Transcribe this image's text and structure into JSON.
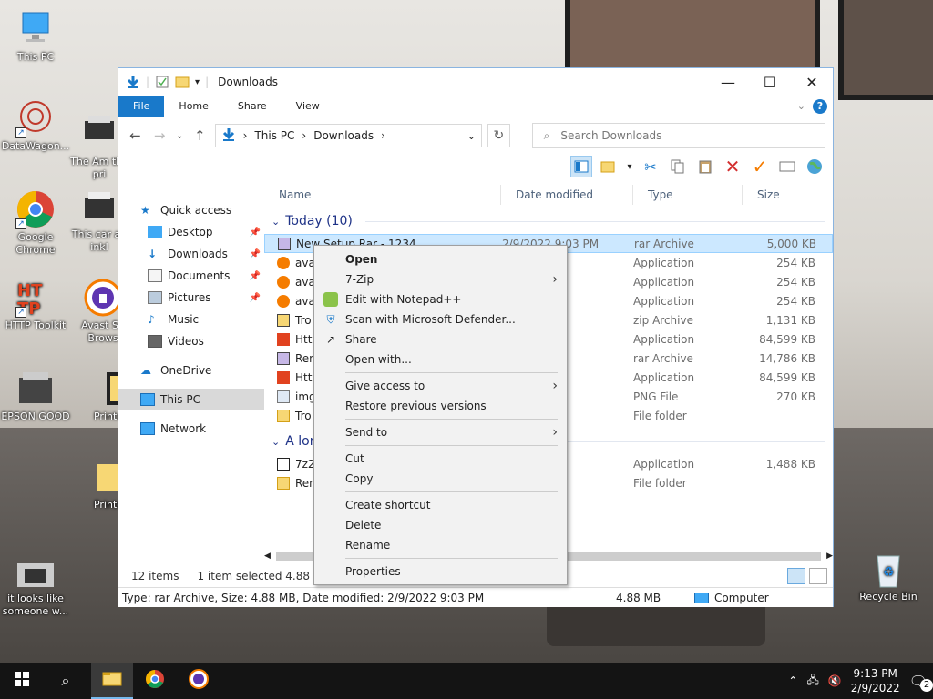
{
  "desktop": {
    "icons": [
      {
        "label": "This PC"
      },
      {
        "label": "DataWagon..."
      },
      {
        "label": "The Am the pri"
      },
      {
        "label": "Google Chrome"
      },
      {
        "label": "This car an inkl"
      },
      {
        "label": "HTTP Toolkit"
      },
      {
        "label": "Avast Se Brows"
      },
      {
        "label": "EPSON GOOD"
      },
      {
        "label": "Printe"
      },
      {
        "label": "Printe"
      },
      {
        "label": "it looks like someone w..."
      },
      {
        "label": "Recycle Bin"
      }
    ]
  },
  "window": {
    "title": "Downloads",
    "ribbon_tabs": [
      "File",
      "Home",
      "Share",
      "View"
    ],
    "address": {
      "crumb1": "This PC",
      "crumb2": "Downloads"
    },
    "search_placeholder": "Search Downloads",
    "nav_pane": {
      "quick_access": "Quick access",
      "desktop": "Desktop",
      "downloads": "Downloads",
      "documents": "Documents",
      "pictures": "Pictures",
      "music": "Music",
      "videos": "Videos",
      "onedrive": "OneDrive",
      "this_pc": "This PC",
      "network": "Network"
    },
    "columns": {
      "name": "Name",
      "date": "Date modified",
      "type": "Type",
      "size": "Size"
    },
    "groups": {
      "today": "Today (10)",
      "long_ago": "A lon"
    },
    "files_today": [
      {
        "name": "New Setup Rar - 1234",
        "date": "2/9/2022 9:03 PM",
        "type": "rar Archive",
        "size": "5,000 KB"
      },
      {
        "name": "ava",
        "date": "40 PM",
        "type": "Application",
        "size": "254 KB"
      },
      {
        "name": "ava",
        "date": "39 PM",
        "type": "Application",
        "size": "254 KB"
      },
      {
        "name": "ava",
        "date": "31 PM",
        "type": "Application",
        "size": "254 KB"
      },
      {
        "name": "Tro",
        "date": "30 PM",
        "type": "zip Archive",
        "size": "1,131 KB"
      },
      {
        "name": "Htt",
        "date": "14 PM",
        "type": "Application",
        "size": "84,599 KB"
      },
      {
        "name": "Ren",
        "date": "12 PM",
        "type": "rar Archive",
        "size": "14,786 KB"
      },
      {
        "name": "Htt",
        "date": "12 PM",
        "type": "Application",
        "size": "84,599 KB"
      },
      {
        "name": "img",
        "date": "40 PM",
        "type": "PNG File",
        "size": "270 KB"
      },
      {
        "name": "Tro",
        "date": "30 PM",
        "type": "File folder",
        "size": ""
      }
    ],
    "files_older": [
      {
        "name": "7z2",
        "date": "3:47 AM",
        "type": "Application",
        "size": "1,488 KB"
      },
      {
        "name": "Ren",
        "date": "9:58 AM",
        "type": "File folder",
        "size": ""
      }
    ],
    "status": {
      "items": "12 items",
      "selected": "1 item selected  4.88 MB"
    },
    "details": {
      "info": "Type: rar Archive, Size: 4.88 MB, Date modified: 2/9/2022 9:03 PM",
      "size": "4.88 MB",
      "location": "Computer"
    }
  },
  "context_menu": {
    "open": "Open",
    "zip": "7-Zip",
    "notepad": "Edit with Notepad++",
    "defender": "Scan with Microsoft Defender...",
    "share": "Share",
    "open_with": "Open with...",
    "give_access": "Give access to",
    "restore": "Restore previous versions",
    "send_to": "Send to",
    "cut": "Cut",
    "copy": "Copy",
    "create_shortcut": "Create shortcut",
    "delete": "Delete",
    "rename": "Rename",
    "properties": "Properties"
  },
  "taskbar": {
    "time": "9:13 PM",
    "date": "2/9/2022",
    "notifications": "2"
  },
  "colors": {
    "accent": "#1979ca",
    "selection": "#cce8ff"
  }
}
